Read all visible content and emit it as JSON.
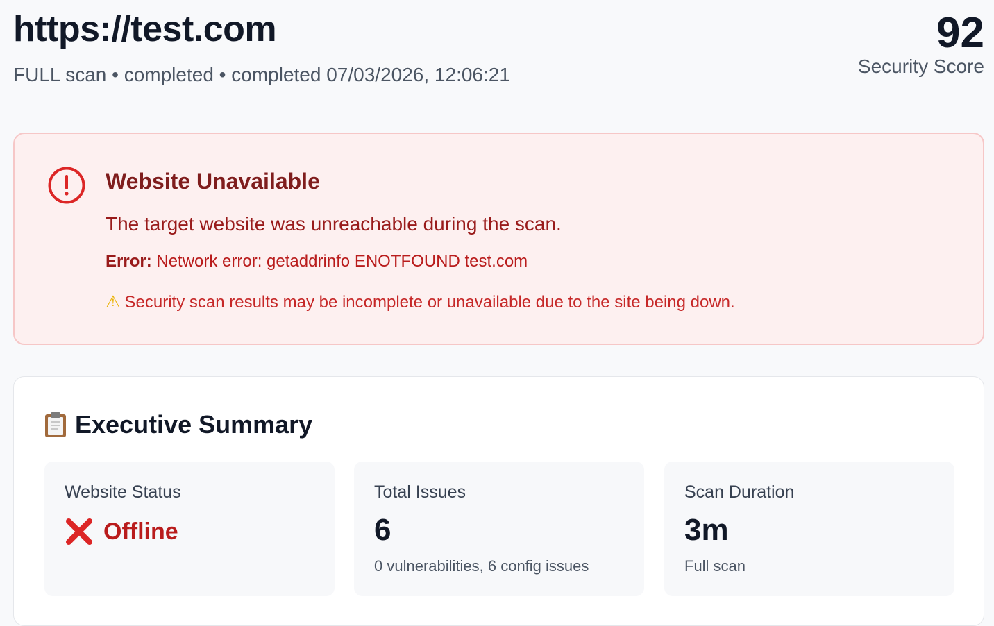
{
  "header": {
    "site_url": "https://test.com",
    "scan_meta": "FULL scan • completed • completed 07/03/2026, 12:06:21",
    "score_value": "92",
    "score_label": "Security Score"
  },
  "alert": {
    "icon": "alert-circle-icon",
    "title": "Website Unavailable",
    "description": "The target website was unreachable during the scan.",
    "error_label": "Error:",
    "error_text": "Network error: getaddrinfo ENOTFOUND test.com",
    "warning_icon": "warning-icon",
    "warning_text": "Security scan results may be incomplete or unavailable due to the site being down.",
    "colors": {
      "background": "#fdf0f0",
      "border": "#f6c7c7",
      "text": "#991b1b"
    }
  },
  "summary": {
    "icon": "clipboard-icon",
    "title": "Executive Summary",
    "stats": [
      {
        "label": "Website Status",
        "icon": "x-mark-icon",
        "value": "Offline",
        "sub": ""
      },
      {
        "label": "Total Issues",
        "value": "6",
        "sub": "0 vulnerabilities, 6 config issues"
      },
      {
        "label": "Scan Duration",
        "value": "3m",
        "sub": "Full scan"
      }
    ]
  }
}
